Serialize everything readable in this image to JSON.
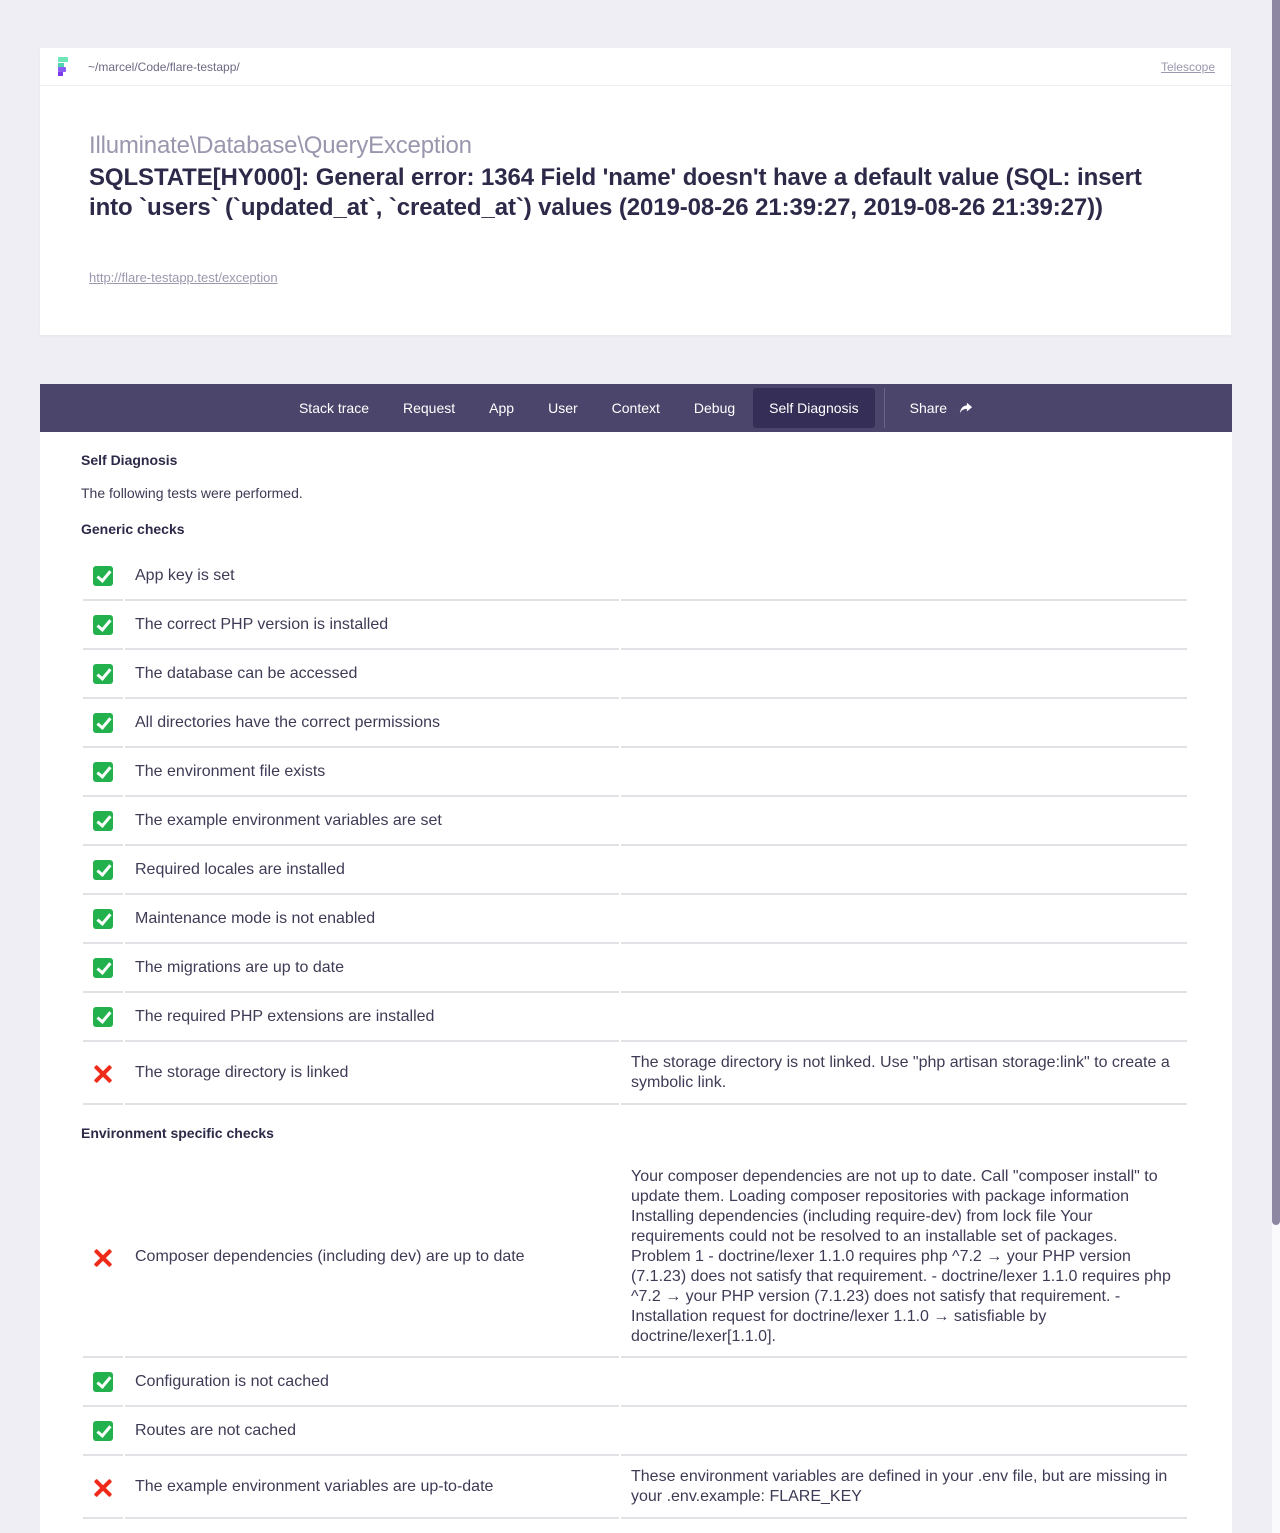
{
  "header": {
    "path": "~/marcel/Code/flare-testapp/",
    "telescope_link": "Telescope",
    "exception_class": "Illuminate\\Database\\QueryException",
    "exception_message": "SQLSTATE[HY000]: General error: 1364 Field 'name' doesn't have a default value (SQL: insert into `users` (`updated_at`, `created_at`) values (2019-08-26 21:39:27, 2019-08-26 21:39:27))",
    "url": "http://flare-testapp.test/exception"
  },
  "nav": {
    "tabs": [
      {
        "label": "Stack trace",
        "active": false
      },
      {
        "label": "Request",
        "active": false
      },
      {
        "label": "App",
        "active": false
      },
      {
        "label": "User",
        "active": false
      },
      {
        "label": "Context",
        "active": false
      },
      {
        "label": "Debug",
        "active": false
      },
      {
        "label": "Self Diagnosis",
        "active": true
      }
    ],
    "share_label": "Share"
  },
  "content": {
    "title": "Self Diagnosis",
    "intro": "The following tests were performed.",
    "generic_title": "Generic checks",
    "generic_checks": [
      {
        "status": "ok",
        "name": "App key is set",
        "message": ""
      },
      {
        "status": "ok",
        "name": "The correct PHP version is installed",
        "message": ""
      },
      {
        "status": "ok",
        "name": "The database can be accessed",
        "message": ""
      },
      {
        "status": "ok",
        "name": "All directories have the correct permissions",
        "message": ""
      },
      {
        "status": "ok",
        "name": "The environment file exists",
        "message": ""
      },
      {
        "status": "ok",
        "name": "The example environment variables are set",
        "message": ""
      },
      {
        "status": "ok",
        "name": "Required locales are installed",
        "message": ""
      },
      {
        "status": "ok",
        "name": "Maintenance mode is not enabled",
        "message": ""
      },
      {
        "status": "ok",
        "name": "The migrations are up to date",
        "message": ""
      },
      {
        "status": "ok",
        "name": "The required PHP extensions are installed",
        "message": ""
      },
      {
        "status": "fail",
        "name": "The storage directory is linked",
        "message": "The storage directory is not linked. Use \"php artisan storage:link\" to create a symbolic link."
      }
    ],
    "env_title": "Environment specific checks",
    "env_checks": [
      {
        "status": "fail",
        "name": "Composer dependencies (including dev) are up to date",
        "message": "Your composer dependencies are not up to date. Call \"composer install\" to update them. Loading composer repositories with package information Installing dependencies (including require-dev) from lock file Your requirements could not be resolved to an installable set of packages. Problem 1 - doctrine/lexer 1.1.0 requires php ^7.2 → your PHP version (7.1.23) does not satisfy that requirement. - doctrine/lexer 1.1.0 requires php ^7.2 → your PHP version (7.1.23) does not satisfy that requirement. - Installation request for doctrine/lexer 1.1.0 → satisfiable by doctrine/lexer[1.1.0]."
      },
      {
        "status": "ok",
        "name": "Configuration is not cached",
        "message": ""
      },
      {
        "status": "ok",
        "name": "Routes are not cached",
        "message": ""
      },
      {
        "status": "fail",
        "name": "The example environment variables are up-to-date",
        "message": "These environment variables are defined in your .env file, but are missing in your .env.example: FLARE_KEY"
      }
    ]
  },
  "colors": {
    "nav_bg": "#4b456b",
    "nav_active": "#352f57",
    "ok": "#22b14c",
    "fail": "#ee2b1a"
  }
}
